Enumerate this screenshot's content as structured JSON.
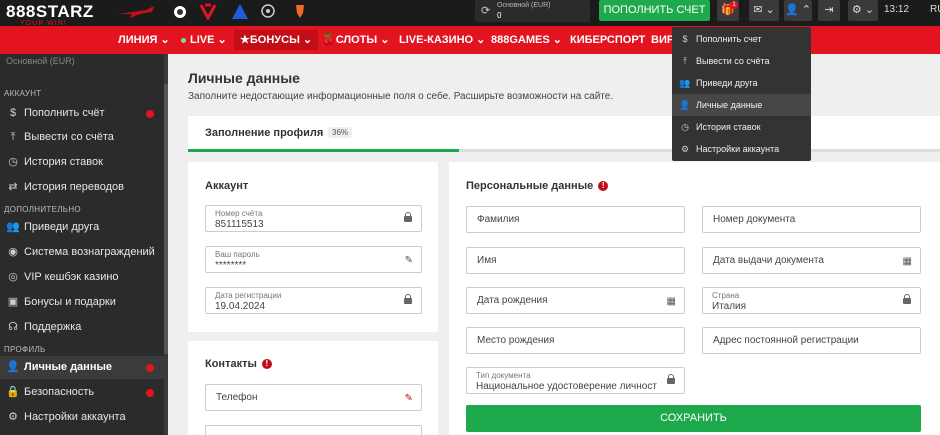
{
  "brand": {
    "logo_main": "888STARZ",
    "logo_sub": "YOUR WIN!"
  },
  "sponsors": [
    "airplane-sponsor-icon",
    "football-club-icon",
    "lazio-icon",
    "atalanta-icon",
    "champions-league-icon",
    "europa-league-icon"
  ],
  "header": {
    "balance_label": "Основной (EUR)",
    "balance_value": "0",
    "deposit_button": "ПОПОЛНИТЬ СЧЕТ",
    "gift_badge": "1",
    "time": "13:12",
    "lang": "RU"
  },
  "nav": {
    "items": [
      "ЛИНИЯ",
      "LIVE",
      "БОНУСЫ",
      "СЛОТЫ",
      "LIVE-КАЗИНО",
      "888GAMES",
      "КИБЕРСПОРТ",
      "ВИР"
    ]
  },
  "sidebar": {
    "top_partial": "Основной (EUR)",
    "section_account": "АККАУНТ",
    "section_extra": "ДОПОЛНИТЕЛЬНО",
    "section_profile": "ПРОФИЛЬ",
    "items": [
      {
        "label": "Пополнить счёт",
        "icon": "dollar-icon"
      },
      {
        "label": "Вывести со счёта",
        "icon": "withdraw-icon"
      },
      {
        "label": "История ставок",
        "icon": "history-icon"
      },
      {
        "label": "История переводов",
        "icon": "transfer-icon"
      },
      {
        "label": "Приведи друга",
        "icon": "friends-icon"
      },
      {
        "label": "Система вознаграждений",
        "icon": "reward-icon"
      },
      {
        "label": "VIP кешбэк казино",
        "icon": "vip-icon"
      },
      {
        "label": "Бонусы и подарки",
        "icon": "gift-icon"
      },
      {
        "label": "Поддержка",
        "icon": "support-icon"
      },
      {
        "label": "Личные данные",
        "icon": "user-icon"
      },
      {
        "label": "Безопасность",
        "icon": "lock-icon"
      },
      {
        "label": "Настройки аккаунта",
        "icon": "gear-icon"
      }
    ]
  },
  "page": {
    "title": "Личные данные",
    "subtitle": "Заполните недостающие информационные поля о себе. Расширьте возможности на сайте.",
    "progress_label": "Заполнение профиля",
    "progress_percent": "36%",
    "progress_fraction": 0.36
  },
  "account": {
    "title": "Аккаунт",
    "number_label": "Номер счёта",
    "number_value": "851115513",
    "password_label": "Ваш пароль",
    "password_value": "********",
    "reg_label": "Дата регистрации",
    "reg_value": "19.04.2024"
  },
  "contacts": {
    "title": "Контакты",
    "phone_placeholder": "Телефон"
  },
  "personal": {
    "title": "Персональные данные",
    "surname": "Фамилия",
    "doc_number": "Номер документа",
    "name": "Имя",
    "doc_date": "Дата выдачи документа",
    "birth_date": "Дата рождения",
    "country_label": "Страна",
    "country_value": "Италия",
    "birth_place": "Место рождения",
    "address": "Адрес постоянной регистрации",
    "doc_type_label": "Тип документа",
    "doc_type_value": "Национальное удостоверение личност",
    "save": "СОХРАНИТЬ"
  },
  "dropdown": {
    "items": [
      "Пополнить счет",
      "Вывести со счёта",
      "Приведи друга",
      "Личные данные",
      "История ставок",
      "Настройки аккаунта"
    ]
  },
  "colors": {
    "brand_red": "#e3141f",
    "green": "#1ea94c",
    "dark": "#2b2b2b"
  }
}
